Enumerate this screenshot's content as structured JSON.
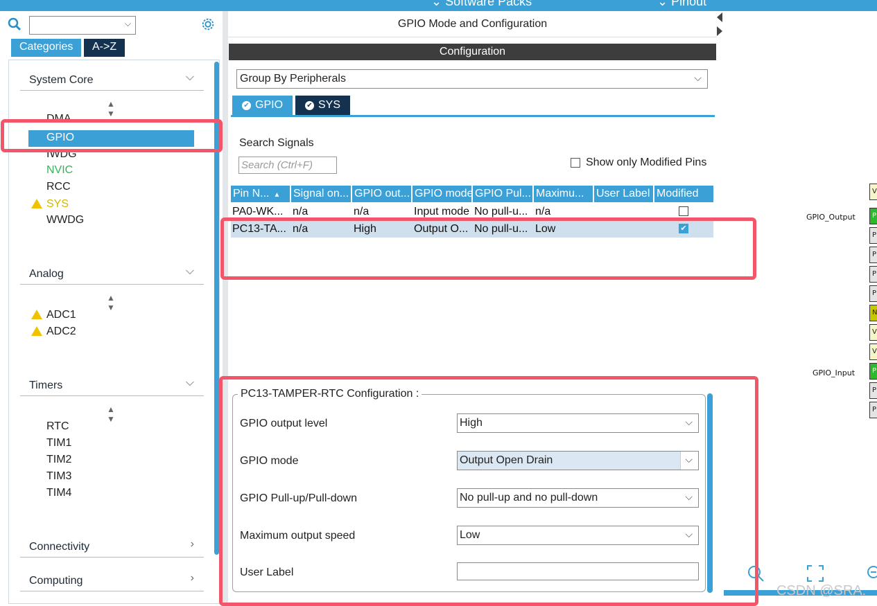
{
  "topbar": {
    "software_packs": "Software Packs",
    "pinout": "Pinout"
  },
  "left": {
    "tabs": [
      "Categories",
      "A->Z"
    ],
    "sections": [
      {
        "title": "System Core",
        "items": [
          {
            "label": "DMA",
            "status": "normal"
          },
          {
            "label": "GPIO",
            "status": "selected"
          },
          {
            "label": "IWDG",
            "status": "normal"
          },
          {
            "label": "NVIC",
            "status": "green"
          },
          {
            "label": "RCC",
            "status": "normal"
          },
          {
            "label": "SYS",
            "status": "warning"
          },
          {
            "label": "WWDG",
            "status": "normal"
          }
        ]
      },
      {
        "title": "Analog",
        "items": [
          {
            "label": "ADC1",
            "status": "warning"
          },
          {
            "label": "ADC2",
            "status": "warning"
          }
        ]
      },
      {
        "title": "Timers",
        "items": [
          {
            "label": "RTC",
            "status": "normal"
          },
          {
            "label": "TIM1",
            "status": "normal"
          },
          {
            "label": "TIM2",
            "status": "normal"
          },
          {
            "label": "TIM3",
            "status": "normal"
          },
          {
            "label": "TIM4",
            "status": "normal"
          }
        ]
      },
      {
        "title": "Connectivity",
        "items": []
      },
      {
        "title": "Computing",
        "items": []
      }
    ]
  },
  "center": {
    "title": "GPIO Mode and Configuration",
    "config_header": "Configuration",
    "group_by": "Group By Peripherals",
    "peripheral_tabs": [
      "GPIO",
      "SYS"
    ],
    "search_label": "Search Signals",
    "search_placeholder": "Search (Ctrl+F)",
    "show_modified_label": "Show only Modified Pins",
    "table": {
      "headers": [
        "Pin N...",
        "Signal on...",
        "GPIO out...",
        "GPIO mode",
        "GPIO Pul...",
        "Maximu...",
        "User Label",
        "Modified"
      ],
      "rows": [
        {
          "cells": [
            "PA0-WK...",
            "n/a",
            "n/a",
            "Input mode",
            "No pull-u...",
            "n/a",
            ""
          ],
          "modified": false
        },
        {
          "cells": [
            "PC13-TA...",
            "n/a",
            "High",
            "Output O...",
            "No pull-u...",
            "Low",
            ""
          ],
          "modified": true
        }
      ]
    },
    "pin_config": {
      "title": "PC13-TAMPER-RTC Configuration :",
      "fields": [
        {
          "label": "GPIO output level",
          "value": "High"
        },
        {
          "label": "GPIO mode",
          "value": "Output Open Drain"
        },
        {
          "label": "GPIO Pull-up/Pull-down",
          "value": "No pull-up and no pull-down"
        },
        {
          "label": "Maximum output speed",
          "value": "Low"
        },
        {
          "label": "User Label",
          "value": ""
        }
      ]
    }
  },
  "right": {
    "labels": [
      "GPIO_Output",
      "GPIO_Input"
    ],
    "pins": [
      "V",
      "P",
      "P",
      "P",
      "P",
      "P",
      "N",
      "V",
      "V",
      "P",
      "P",
      "P"
    ],
    "watermark": "CSDN @SRA."
  },
  "colors": {
    "accent": "#3aa0d5",
    "dark_tab": "#143250",
    "highlight": "#f2566a"
  }
}
